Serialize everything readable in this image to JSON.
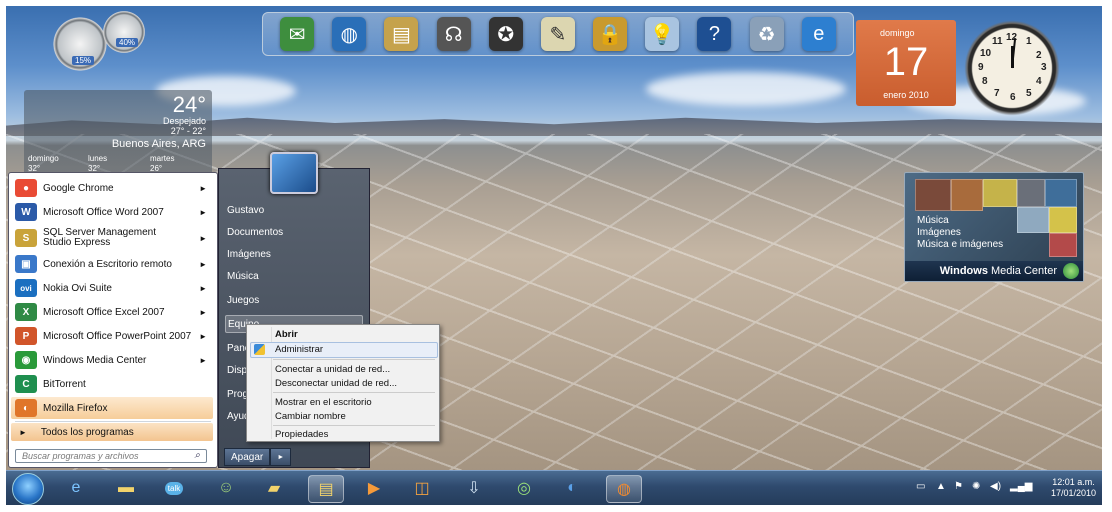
{
  "dock": {
    "icons": [
      "message-icon",
      "globe-icon",
      "photos-icon",
      "headphones-icon",
      "film-reel-icon",
      "notepad-icon",
      "lock-icon",
      "lightbulb-icon",
      "help-icon",
      "recycle-bin-icon",
      "internet-explorer-icon"
    ]
  },
  "gauges": {
    "cpu": "15%",
    "memory": "40%"
  },
  "weather": {
    "temp": "24°",
    "condition": "Despejado",
    "range": "27° - 22°",
    "city": "Buenos Aires, ARG",
    "forecast": [
      {
        "day": "domingo",
        "temp": "32°"
      },
      {
        "day": "lunes",
        "temp": "32°"
      },
      {
        "day": "martes",
        "temp": "26°"
      }
    ]
  },
  "calendar": {
    "weekday": "domingo",
    "day": "17",
    "month": "enero 2010"
  },
  "clock": {
    "numbers": [
      "12",
      "1",
      "2",
      "3",
      "4",
      "5",
      "6",
      "7",
      "8",
      "9",
      "10",
      "11"
    ]
  },
  "media_center": {
    "menu": [
      "Música",
      "Imágenes",
      "Música e imágenes"
    ],
    "brand_bold": "Windows",
    "brand_rest": "Media Center"
  },
  "start_menu": {
    "programs": [
      {
        "label": "Google Chrome",
        "icon": "chrome-icon",
        "color": "#e94b35",
        "glyph": "●",
        "submenu": true
      },
      {
        "label": "Microsoft Office Word 2007",
        "icon": "word-icon",
        "color": "#2b5aa8",
        "glyph": "W",
        "submenu": true
      },
      {
        "label": "SQL Server Management Studio Express",
        "icon": "sql-server-icon",
        "color": "#c9a33a",
        "glyph": "S",
        "submenu": true
      },
      {
        "label": "Conexión a Escritorio remoto",
        "icon": "remote-desktop-icon",
        "color": "#3a78c9",
        "glyph": "▣",
        "submenu": true
      },
      {
        "label": "Nokia Ovi Suite",
        "icon": "ovi-icon",
        "color": "#1b6fc0",
        "glyph": "ovi",
        "submenu": true
      },
      {
        "label": "Microsoft Office Excel 2007",
        "icon": "excel-icon",
        "color": "#2f8a45",
        "glyph": "X",
        "submenu": true
      },
      {
        "label": "Microsoft Office PowerPoint 2007",
        "icon": "powerpoint-icon",
        "color": "#d1552a",
        "glyph": "P",
        "submenu": true
      },
      {
        "label": "Windows Media Center",
        "icon": "media-center-icon",
        "color": "#2a9a3a",
        "glyph": "◉",
        "submenu": true
      },
      {
        "label": "BitTorrent",
        "icon": "bittorrent-icon",
        "color": "#1f8f4f",
        "glyph": "C",
        "submenu": false
      },
      {
        "label": "Mozilla Firefox",
        "icon": "firefox-icon",
        "color": "#e0762a",
        "glyph": "◐",
        "submenu": false
      }
    ],
    "all_programs": "Todos los programas",
    "search_placeholder": "Buscar programas y archivos",
    "right_items": [
      "Gustavo",
      "Documentos",
      "Imágenes",
      "Música",
      "Juegos",
      "Equipo",
      "Panel",
      "Dispo",
      "Prog",
      "Ayud"
    ],
    "shutdown": "Apagar",
    "shutdown_arrow": "►"
  },
  "context_menu": {
    "items": [
      "Abrir",
      "Administrar",
      "Conectar a unidad de red...",
      "Desconectar unidad de red...",
      "Mostrar en el escritorio",
      "Cambiar nombre",
      "Propiedades"
    ]
  },
  "taskbar": {
    "icons": [
      "internet-explorer-icon",
      "folder-icon",
      "google-talk-icon",
      "users-icon",
      "folder-icon",
      "explorer-active-icon",
      "media-player-icon",
      "outlook-icon",
      "download-icon",
      "update-icon",
      "network-icon",
      "firefox-icon"
    ],
    "time": "12:01 a.m.",
    "date": "17/01/2010"
  }
}
